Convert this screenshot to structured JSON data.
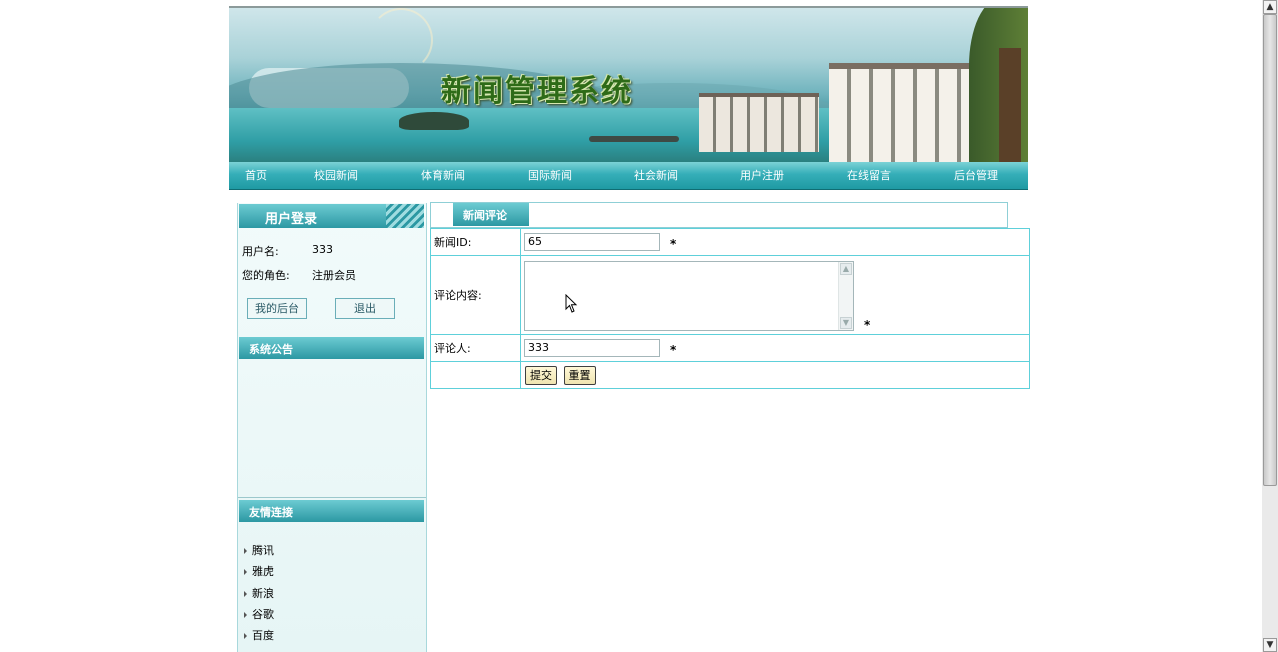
{
  "site_title": "新闻管理系统",
  "nav": [
    "首页",
    "校园新闻",
    "体育新闻",
    "国际新闻",
    "社会新闻",
    "用户注册",
    "在线留言",
    "后台管理"
  ],
  "login": {
    "title": "用户登录",
    "username_label": "用户名:",
    "username_value": "333",
    "role_label": "您的角色:",
    "role_value": "注册会员",
    "my_backend_button": "我的后台",
    "logout_button": "退出"
  },
  "notice": {
    "title": "系统公告"
  },
  "links": {
    "title": "友情连接",
    "items": [
      "腾讯",
      "雅虎",
      "新浪",
      "谷歌",
      "百度"
    ]
  },
  "comment_form": {
    "tab_label": "新闻评论",
    "news_id_label": "新闻ID:",
    "news_id_value": "65",
    "content_label": "评论内容:",
    "content_value": "",
    "commenter_label": "评论人:",
    "commenter_value": "333",
    "required_mark": "*",
    "submit_button": "提交",
    "reset_button": "重置"
  },
  "icons": [
    "mouse-cursor-icon",
    "scroll-up-arrow-icon",
    "scroll-down-arrow-icon",
    "bullet-arrow-icon"
  ],
  "colors": {
    "nav_teal": "#2c98a3",
    "title_green": "#2e6b18",
    "table_border": "#5ed0da"
  }
}
